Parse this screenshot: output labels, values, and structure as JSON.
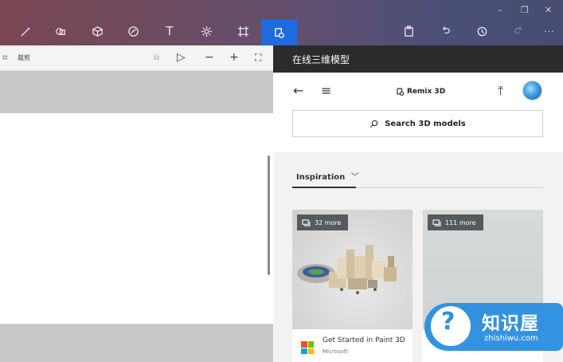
{
  "window": {
    "minimize": "–",
    "restore": "❐",
    "close": "✕"
  },
  "toolbar": {
    "tools": [
      "brush-icon",
      "2d-shapes-icon",
      "3d-shapes-icon",
      "stickers-icon",
      "text-icon",
      "effects-icon",
      "canvas-icon",
      "remix-3d-icon"
    ],
    "text_tool_label": "T",
    "right_icons": [
      "paste-icon",
      "undo-icon",
      "history-icon",
      "redo-icon",
      "more-icon"
    ],
    "more_label": "···",
    "active_color": "#1f6be0"
  },
  "subbar": {
    "crop_label": "裁剪"
  },
  "panel": {
    "title": "在线三维模型",
    "brand": "Remix 3D",
    "search_placeholder": "Search 3D models",
    "tab_label": "Inspiration",
    "cards": [
      {
        "more_label": "32 more",
        "title": "Get Started in Paint 3D",
        "subtitle": "Microsoft"
      },
      {
        "more_label": "111 more",
        "title": "",
        "subtitle": ""
      }
    ]
  },
  "watermark": {
    "text": "知识屋",
    "url": "zhishiwu.com",
    "symbol": "?"
  }
}
